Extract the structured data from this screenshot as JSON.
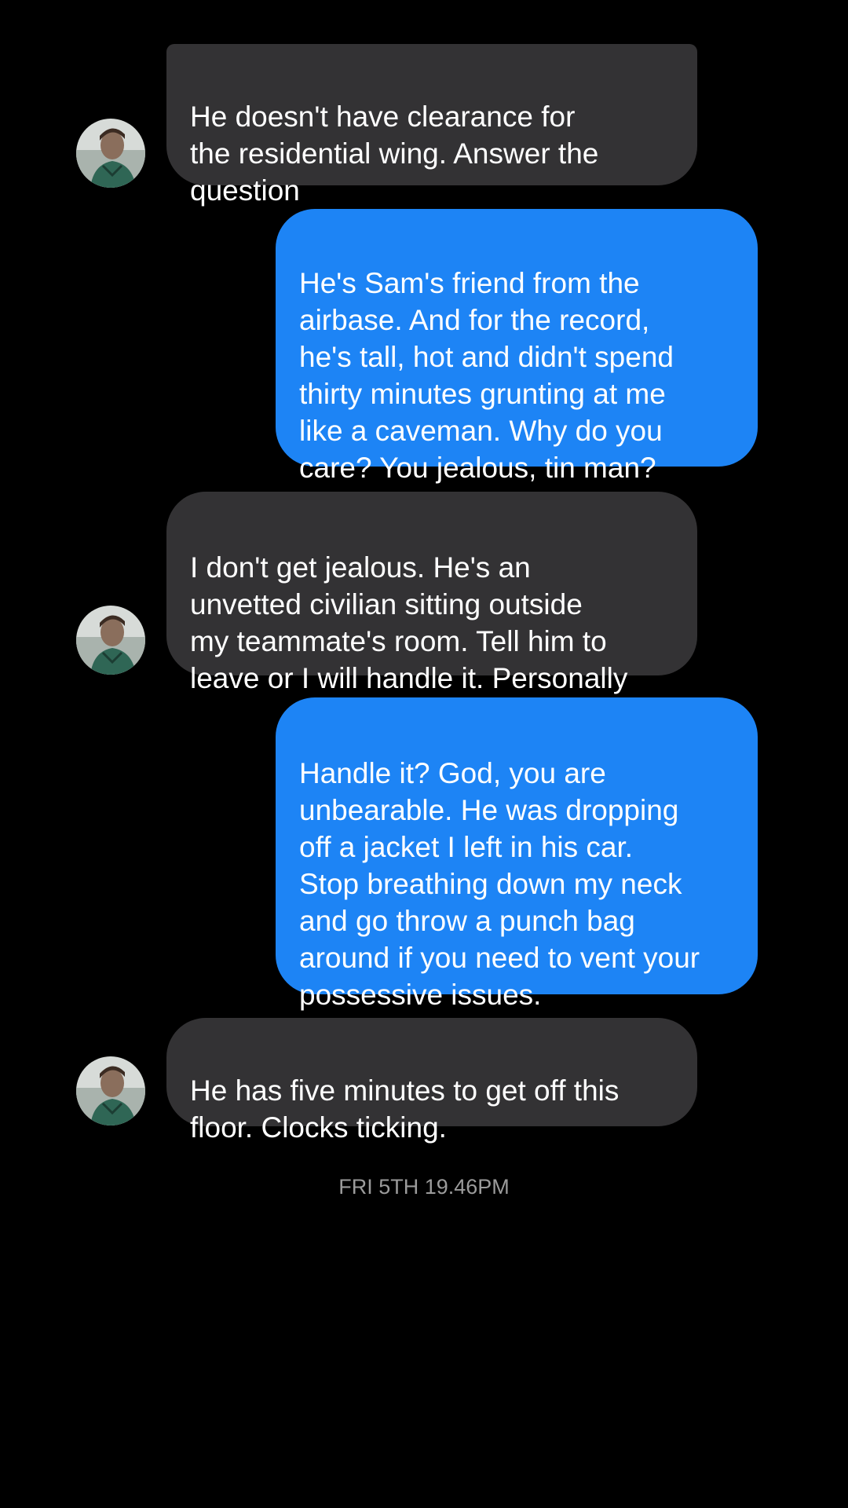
{
  "messages": [
    {
      "sender": "contact",
      "text": "He doesn't have clearance for\nthe residential wing. Answer the\nquestion"
    },
    {
      "sender": "me",
      "text": "He's Sam's friend from the\nairbase. And for the record,\nhe's tall, hot and didn't spend\nthirty minutes grunting at me\nlike a caveman. Why do you\ncare? You jealous,  tin man?"
    },
    {
      "sender": "contact",
      "text": "I don't get jealous.  He's an\nunvetted civilian sitting outside\nmy teammate's room. Tell him to\nleave or I will handle it. Personally"
    },
    {
      "sender": "me",
      "text": "Handle it? God, you are\nunbearable.  He was dropping\noff a jacket I left in his car.\nStop breathing down my neck\nand go throw a punch bag\naround if you need to vent your\npossessive issues."
    },
    {
      "sender": "contact",
      "text": "He has five minutes to get off this\nfloor. Clocks ticking."
    }
  ],
  "timestamp": "FRI 5TH 19.46PM",
  "colors": {
    "background": "#000000",
    "incoming_bubble": "#333234",
    "outgoing_bubble": "#1d84f5",
    "timestamp_text": "#9b9b9b"
  },
  "icons": {
    "contact_avatar": "contact-avatar-icon"
  }
}
